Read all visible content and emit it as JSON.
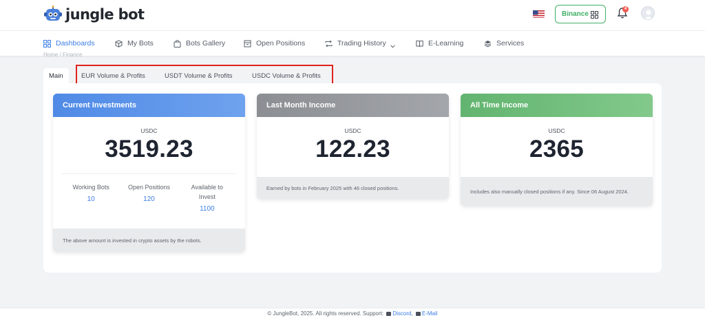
{
  "header": {
    "brand": "jungle bot",
    "exchange_label": "Binance",
    "notification_count": "4"
  },
  "nav": {
    "items": [
      {
        "label": "Dashboards",
        "icon": "dashboard-icon",
        "active": true
      },
      {
        "label": "My Bots",
        "icon": "cube-icon"
      },
      {
        "label": "Bots Gallery",
        "icon": "bag-icon"
      },
      {
        "label": "Open Positions",
        "icon": "archive-icon"
      },
      {
        "label": "Trading History",
        "icon": "repeat-icon"
      },
      {
        "label": "E-Learning",
        "icon": "book-icon"
      },
      {
        "label": "Services",
        "icon": "layers-icon"
      }
    ]
  },
  "breadcrumb": "Home / Finance",
  "tabs": [
    {
      "label": "Main",
      "active": true
    },
    {
      "label": "EUR Volume & Profits"
    },
    {
      "label": "USDT Volume & Profits"
    },
    {
      "label": "USDC Volume & Profits"
    }
  ],
  "cards": {
    "current": {
      "title": "Current Investments",
      "currency": "USDC",
      "amount": "3519.23",
      "color": "#5b93ea",
      "stats": [
        {
          "label": "Working Bots",
          "value": "10"
        },
        {
          "label": "Open Positions",
          "value": "120"
        },
        {
          "label": "Available to Invest",
          "value": "1100"
        }
      ],
      "footnote": "The above amount is invested in crypto assets by the robots."
    },
    "last_month": {
      "title": "Last Month Income",
      "currency": "USDC",
      "amount": "122.23",
      "color": "#909398",
      "footnote": "Earned by bots in February 2025 with 46 closed positions."
    },
    "all_time": {
      "title": "All Time Income",
      "currency": "USDC",
      "amount": "2365",
      "color": "#6fbc7a",
      "footnote": "Includes also manually closed positions if any. Since 06 August 2024."
    }
  },
  "footer": {
    "copyright": "© JungleBot, 2025. All rights reserved. Support:",
    "discord": "Discord",
    "email": "E-Mail"
  }
}
